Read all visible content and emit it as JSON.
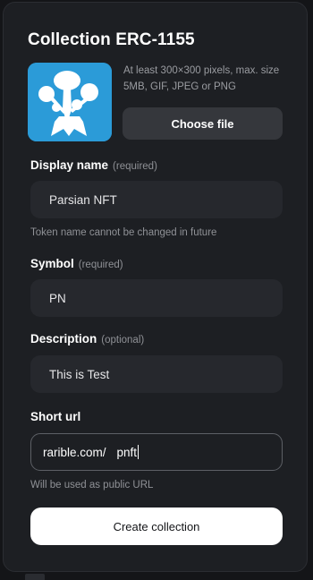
{
  "dialog": {
    "title": "Collection ERC-1155"
  },
  "upload": {
    "hint": "At least 300×300 pixels, max. size 5MB, GIF, JPEG or PNG",
    "choose_file_label": "Choose file",
    "thumbnail_icon": "tree-icon",
    "thumbnail_color": "#2b9bd8"
  },
  "fields": {
    "display_name": {
      "label": "Display name",
      "qualifier": "(required)",
      "value": "Parsian NFT",
      "helper": "Token name cannot be changed in future"
    },
    "symbol": {
      "label": "Symbol",
      "qualifier": "(required)",
      "value": "PN"
    },
    "description": {
      "label": "Description",
      "qualifier": "(optional)",
      "value": "This is Test"
    },
    "short_url": {
      "label": "Short url",
      "prefix": "rarible.com/",
      "value": "pnft",
      "helper": "Will be used as public URL"
    }
  },
  "actions": {
    "create_label": "Create collection"
  },
  "colors": {
    "modal_bg": "#1d1f23",
    "input_bg": "#26282d",
    "primary_button_bg": "#ffffff"
  }
}
